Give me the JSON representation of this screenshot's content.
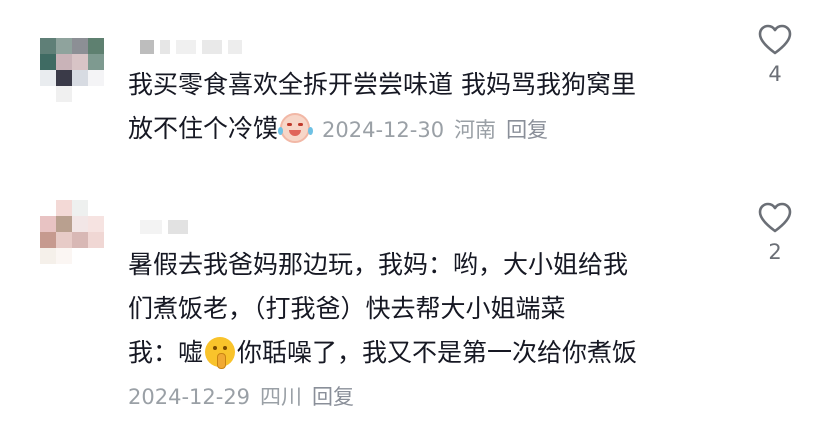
{
  "comments": [
    {
      "lines": [
        "我买零食喜欢全拆开尝尝味道 我妈骂我狗窝里",
        "放不住个冷馍"
      ],
      "emoji": "crying-laughing-emoji",
      "date": "2024-12-30",
      "location": "河南",
      "reply_label": "回复",
      "likes": "4"
    },
    {
      "lines": [
        "暑假去我爸妈那边玩，我妈：哟，大小姐给我",
        "们煮饭老，（打我爸）快去帮大小姐端菜",
        "我：嘘",
        "你聒噪了，我又不是第一次给你煮饭"
      ],
      "emoji": "shushing-face-emoji",
      "date": "2024-12-29",
      "location": "四川",
      "reply_label": "回复",
      "likes": "2"
    }
  ],
  "icons": {
    "like": "heart-outline-icon"
  },
  "colors": {
    "text": "#161823",
    "meta": "#9aa0a6",
    "icon": "#6b6f76"
  }
}
